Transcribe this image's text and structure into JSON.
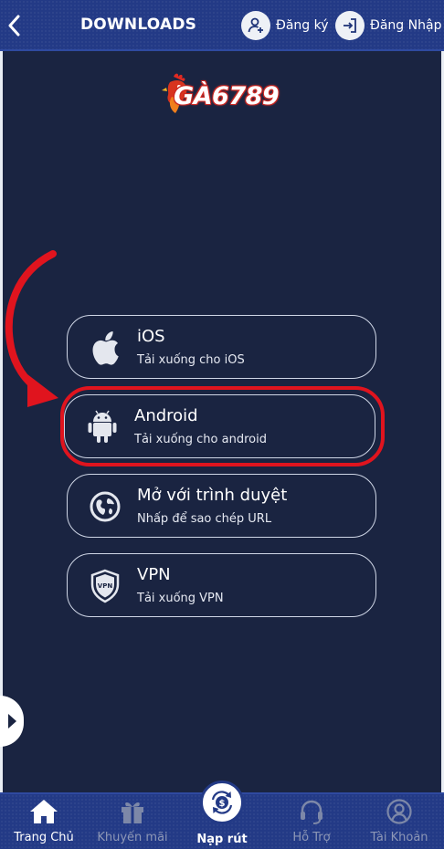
{
  "header": {
    "title": "DOWNLOADS",
    "register_label": "Đăng ký",
    "login_label": "Đăng Nhập"
  },
  "logo": {
    "text": "GÀ6789"
  },
  "options": [
    {
      "title": "iOS",
      "subtitle": "Tải xuống cho iOS",
      "icon": "apple-icon"
    },
    {
      "title": "Android",
      "subtitle": "Tải xuống cho android",
      "icon": "android-icon"
    },
    {
      "title": "Mở với trình duyệt",
      "subtitle": "Nhấp để sao chép URL",
      "icon": "globe-icon"
    },
    {
      "title": "VPN",
      "subtitle": "Tải xuống VPN",
      "icon": "vpn-shield-icon"
    }
  ],
  "bottom_nav": [
    {
      "label": "Trang Chủ",
      "icon": "home-icon",
      "active": true
    },
    {
      "label": "Khuyến mãi",
      "icon": "gift-icon",
      "active": false
    },
    {
      "label": "Nạp rút",
      "icon": "deposit-icon",
      "active": true
    },
    {
      "label": "Hỗ Trợ",
      "icon": "headset-icon",
      "active": false
    },
    {
      "label": "Tài Khoản",
      "icon": "user-icon",
      "active": false
    }
  ],
  "colors": {
    "background": "#1a2441",
    "header": "#233a86",
    "highlight": "#e0141e"
  }
}
